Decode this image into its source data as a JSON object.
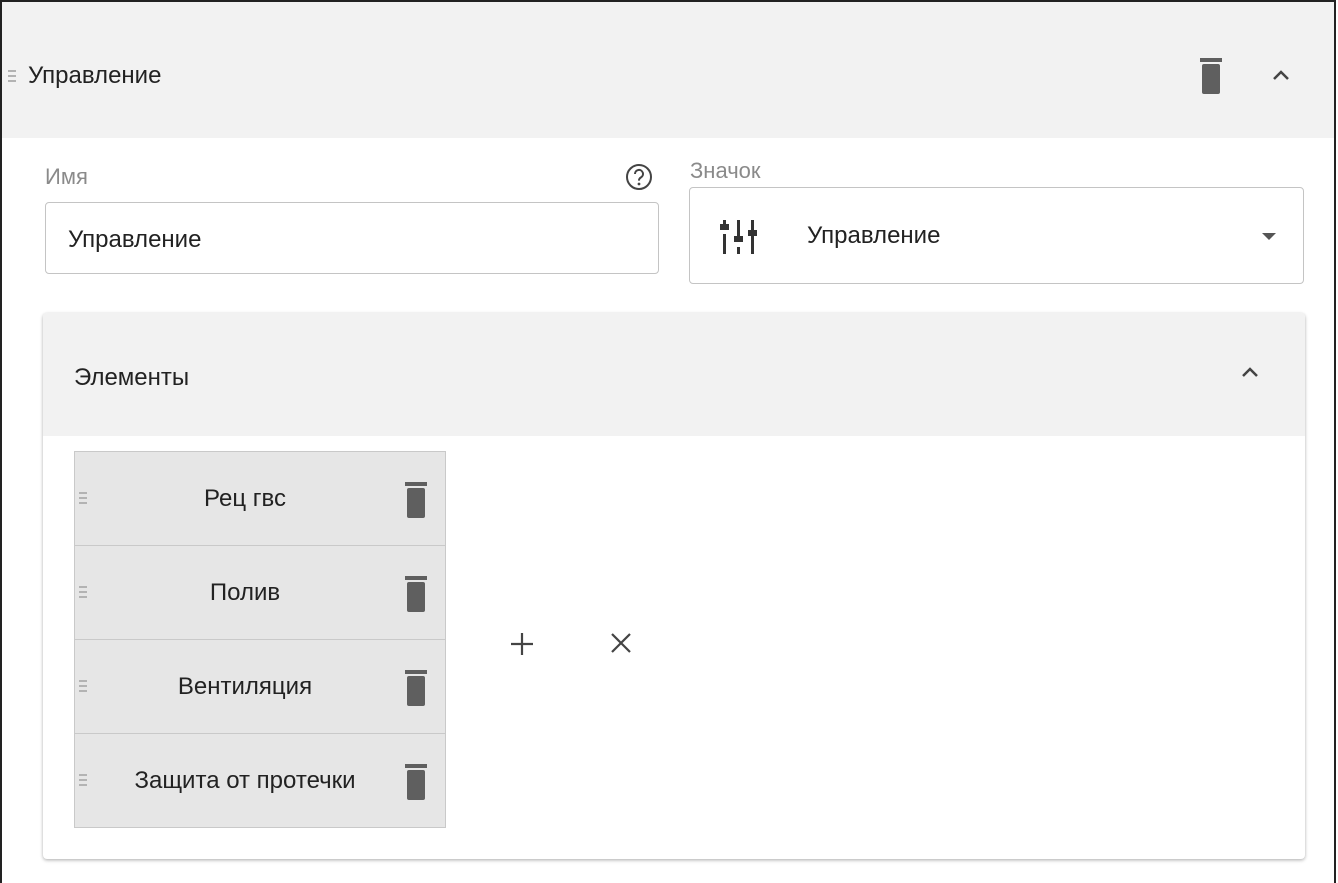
{
  "section": {
    "title": "Управление"
  },
  "name_field": {
    "label": "Имя",
    "value": "Управление"
  },
  "icon_field": {
    "label": "Значок",
    "value": "Управление",
    "icon": "tune-icon"
  },
  "elements": {
    "title": "Элементы",
    "items": [
      {
        "label": "Рец гвс"
      },
      {
        "label": "Полив"
      },
      {
        "label": "Вентиляция"
      },
      {
        "label": "Защита от протечки"
      }
    ]
  },
  "colors": {
    "header_bg": "#f2f2f2",
    "item_bg": "#e6e6e6",
    "icon": "#5f5f5f",
    "label": "#8a8a8a"
  }
}
